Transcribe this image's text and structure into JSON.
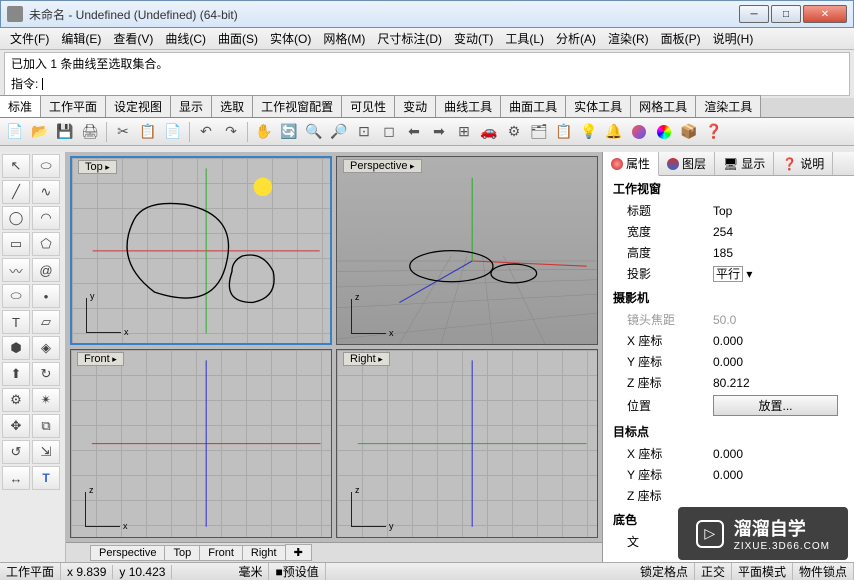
{
  "window": {
    "title": "未命名 - Undefined (Undefined) (64-bit)"
  },
  "menu": [
    "文件(F)",
    "编辑(E)",
    "查看(V)",
    "曲线(C)",
    "曲面(S)",
    "实体(O)",
    "网格(M)",
    "尺寸标注(D)",
    "变动(T)",
    "工具(L)",
    "分析(A)",
    "渲染(R)",
    "面板(P)",
    "说明(H)"
  ],
  "command": {
    "history": "已加入 1 条曲线至选取集合。",
    "prompt_label": "指令:"
  },
  "tabs": [
    "标准",
    "工作平面",
    "设定视图",
    "显示",
    "选取",
    "工作视窗配置",
    "可见性",
    "变动",
    "曲线工具",
    "曲面工具",
    "实体工具",
    "网格工具",
    "渲染工具"
  ],
  "viewports": {
    "top": "Top",
    "perspective": "Perspective",
    "front": "Front",
    "right": "Right",
    "tabs": [
      "Perspective",
      "Top",
      "Front",
      "Right"
    ]
  },
  "panel": {
    "tabs": {
      "attr": "属性",
      "layer": "图层",
      "display": "显示",
      "help": "说明"
    },
    "sections": {
      "viewport": {
        "hdr": "工作视窗",
        "title_lbl": "标题",
        "title_val": "Top",
        "width_lbl": "宽度",
        "width_val": "254",
        "height_lbl": "高度",
        "height_val": "185",
        "proj_lbl": "投影",
        "proj_val": "平行"
      },
      "camera": {
        "hdr": "摄影机",
        "lens_lbl": "镜头焦距",
        "lens_val": "50.0",
        "x_lbl": "X 座标",
        "x_val": "0.000",
        "y_lbl": "Y 座标",
        "y_val": "0.000",
        "z_lbl": "Z 座标",
        "z_val": "80.212",
        "pos_lbl": "位置",
        "pos_btn": "放置..."
      },
      "target": {
        "hdr": "目标点",
        "x_lbl": "X 座标",
        "x_val": "0.000",
        "y_lbl": "Y 座标",
        "y_val": "0.000",
        "z_lbl": "Z 座标"
      },
      "bottom": {
        "hdr": "底色",
        "txt_lbl": "文"
      }
    }
  },
  "status": {
    "plane": "工作平面",
    "x": "x 9.839",
    "y": "y 10.423",
    "unit": "毫米",
    "preset": "预设值",
    "snap": "锁定格点",
    "ortho": "正交",
    "planar": "平面模式",
    "osnap": "物件锁点"
  },
  "watermark": {
    "big": "溜溜自学",
    "small": "ZIXUE.3D66.COM"
  }
}
